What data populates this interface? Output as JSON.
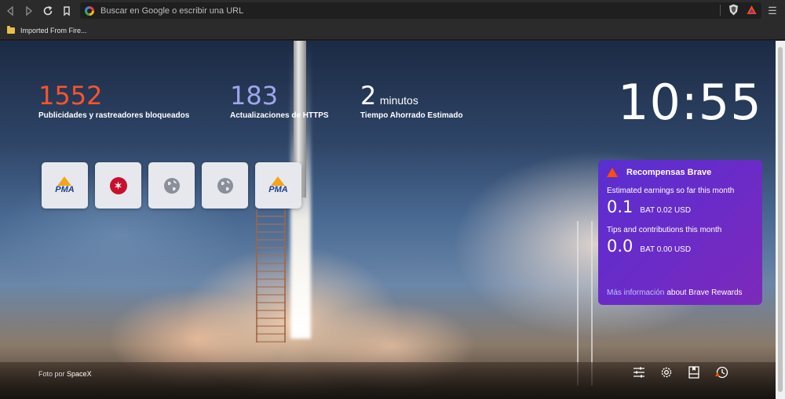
{
  "browser": {
    "omnibox_placeholder": "Buscar en Google o escribir una URL",
    "bookmarks": [
      {
        "label": "Imported From Fire..."
      }
    ]
  },
  "stats": {
    "trackers": {
      "value": "1552",
      "label": "Publicidades y rastreadores bloqueados",
      "color": "#fb542b"
    },
    "https": {
      "value": "183",
      "label": "Actualizaciones de HTTPS",
      "color": "#a0a5eb"
    },
    "time": {
      "value": "2",
      "unit": "minutos",
      "label": "Tiempo Ahorrado Estimado",
      "color": "#ffffff"
    }
  },
  "clock": "10:55",
  "top_sites": [
    {
      "name": "pma",
      "logo_text": "PMA"
    },
    {
      "name": "red-logo",
      "logo_text": "✶"
    },
    {
      "name": "globe"
    },
    {
      "name": "globe"
    },
    {
      "name": "pma",
      "logo_text": "PMA"
    }
  ],
  "rewards": {
    "title": "Recompensas Brave",
    "earnings_label": "Estimated earnings so far this month",
    "earnings_value": "0.1",
    "earnings_bat": "BAT 0.02 USD",
    "tips_label": "Tips and contributions this month",
    "tips_value": "0.0",
    "tips_bat": "BAT 0.00 USD",
    "link_text": "Más información",
    "link_suffix": "about Brave Rewards"
  },
  "photo_credit": {
    "prefix": "Foto por",
    "author": "SpaceX"
  },
  "bottom_icons": [
    "sliders-icon",
    "gear-icon",
    "bookmark-icon",
    "history-icon"
  ]
}
